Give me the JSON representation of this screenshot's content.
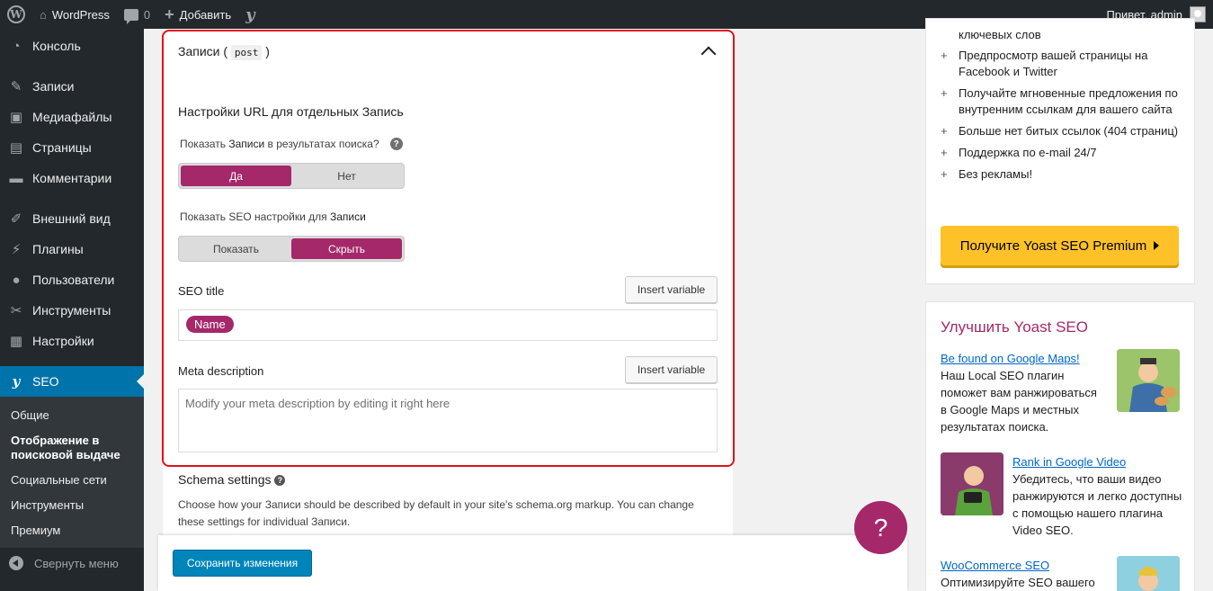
{
  "adminbar": {
    "site_name": "WordPress",
    "comments_count": "0",
    "new_label": "Добавить",
    "greeting": "Привет, admin",
    "icons": [
      "wordpress-icon",
      "comment-icon",
      "plus-icon",
      "yoast-icon",
      "avatar"
    ]
  },
  "sidebar": {
    "items": [
      {
        "label": "Консоль",
        "icon": "dashboard-icon"
      },
      {
        "label": "Записи",
        "icon": "pin-icon"
      },
      {
        "label": "Медиафайлы",
        "icon": "media-icon"
      },
      {
        "label": "Страницы",
        "icon": "pages-icon"
      },
      {
        "label": "Комментарии",
        "icon": "comments-icon"
      },
      {
        "label": "Внешний вид",
        "icon": "brush-icon"
      },
      {
        "label": "Плагины",
        "icon": "plugin-icon"
      },
      {
        "label": "Пользователи",
        "icon": "users-icon"
      },
      {
        "label": "Инструменты",
        "icon": "tools-icon"
      },
      {
        "label": "Настройки",
        "icon": "settings-icon"
      },
      {
        "label": "SEO",
        "icon": "yoast-icon"
      }
    ],
    "submenu": [
      "Общие",
      "Отображение в поисковой выдаче",
      "Социальные сети",
      "Инструменты",
      "Премиум"
    ],
    "collapse_label": "Свернуть меню"
  },
  "panel": {
    "title": "Записи (",
    "title_code": "post",
    "title_close": ")",
    "section_heading": "Настройки URL для отдельных Запись",
    "show_in_search_prefix": "Показать ",
    "show_in_search_bold": "Записи",
    "show_in_search_suffix": " в результатах поиска?",
    "toggle1": {
      "yes": "Да",
      "no": "Нет",
      "selected": "Да"
    },
    "seo_settings_prefix": "Показать SEO настройки для ",
    "seo_settings_bold": "Записи",
    "toggle2": {
      "show": "Показать",
      "hide": "Скрыть",
      "selected": "Скрыть"
    },
    "seo_title_label": "SEO title",
    "insert_variable": "Insert variable",
    "seo_title_pill": "Name",
    "meta_label": "Meta description",
    "meta_placeholder": "Modify your meta description by editing it right here",
    "schema_title": "Schema settings",
    "schema_desc": "Choose how your Записи should be described by default in your site's schema.org markup. You can change these settings for individual Записи."
  },
  "savebar": {
    "save_label": "Сохранить изменения"
  },
  "help_button": "?",
  "premium_box": {
    "partial_item": "ключевых слов",
    "items": [
      "Предпросмотр вашей страницы на Facebook и Twitter",
      "Получайте мгновенные предложения по внутренним ссылкам для вашего сайта",
      "Больше нет битых ссылок (404 страниц)",
      "Поддержка по e-mail 24/7",
      "Без рекламы!"
    ],
    "button": "Получите Yoast SEO Premium"
  },
  "improve_box": {
    "title": "Улучшить Yoast SEO",
    "entries": [
      {
        "link": "Be found on Google Maps!",
        "text": "Наш Local SEO плагин поможет вам ранжироваться в Google Maps и местных результатах поиска."
      },
      {
        "link": "Rank in Google Video",
        "text": "Убедитесь, что ваши видео ранжируются и легко доступны с помощью нашего плагина Video SEO."
      },
      {
        "link": "WooCommerce SEO",
        "text": "Оптимизируйте SEO вашего"
      }
    ]
  },
  "colors": {
    "accent": "#a4286a",
    "wp_blue": "#0073aa",
    "premium_yellow": "#fec228",
    "highlight": "#e1111a"
  }
}
